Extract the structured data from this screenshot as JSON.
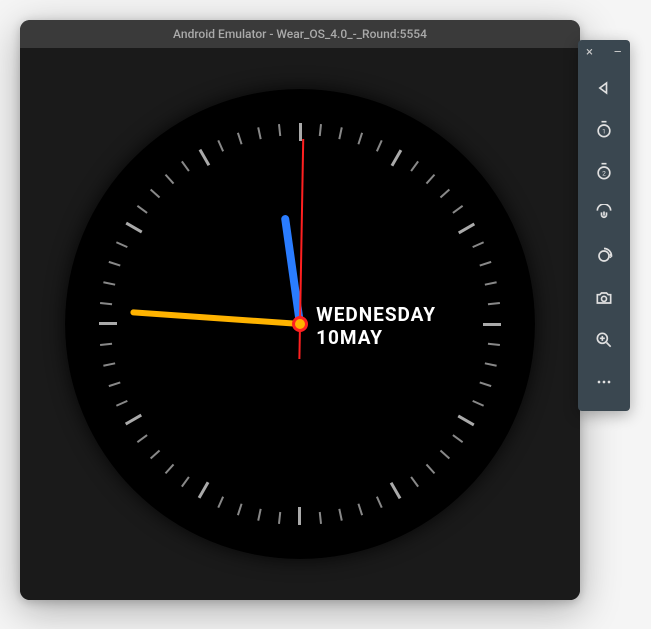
{
  "window": {
    "title": "Android Emulator - Wear_OS_4.0_-_Round:5554"
  },
  "watch": {
    "day_name": "WEDNESDAY",
    "day_number": "10",
    "month": "MAY",
    "hour_angle": -8,
    "minute_angle": -86,
    "second_angle": 1,
    "colors": {
      "hour_hand": "#2a7cff",
      "minute_hand": "#ffb300",
      "second_hand": "#ff2020"
    }
  },
  "toolbar": {
    "close": "×",
    "minimize": "–",
    "items": [
      {
        "name": "back",
        "icon": "back-icon"
      },
      {
        "name": "btn1",
        "icon": "btn1-icon"
      },
      {
        "name": "btn2",
        "icon": "btn2-icon"
      },
      {
        "name": "palm",
        "icon": "palm-icon"
      },
      {
        "name": "tilt",
        "icon": "tilt-icon"
      },
      {
        "name": "camera",
        "icon": "camera-icon"
      },
      {
        "name": "zoom",
        "icon": "zoom-icon"
      },
      {
        "name": "more",
        "icon": "more-icon"
      }
    ]
  }
}
